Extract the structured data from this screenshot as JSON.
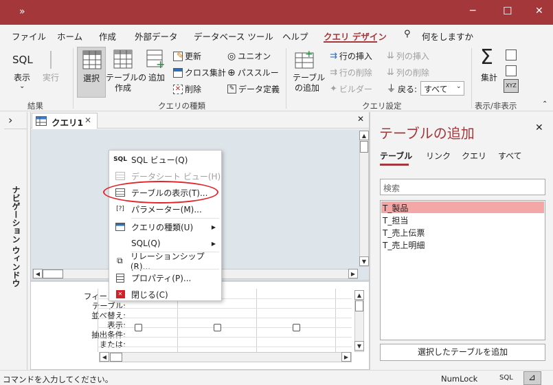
{
  "titlebar": {
    "qat_label": "»",
    "minimize": "─",
    "maximize": "☐",
    "close": "✕"
  },
  "tabs": [
    "ファイル",
    "ホーム",
    "作成",
    "外部データ",
    "データベース ツール",
    "ヘルプ",
    "クエリ デザイン"
  ],
  "tell_me": "何をしますか",
  "ribbon": {
    "results": {
      "sql_icon": "SQL",
      "view": "表示",
      "view_arrow": "⌄",
      "run": "実行",
      "group": "結果"
    },
    "query_type": {
      "select": "選択",
      "make_table_line1": "テーブルの",
      "make_table_line2": "作成",
      "append": "追加",
      "update": "更新",
      "crosstab": "クロス集計",
      "delete": "削除",
      "union": "ユニオン",
      "passthrough": "パススルー",
      "data_def": "データ定義",
      "group": "クエリの種類"
    },
    "setup": {
      "add_tables_line1": "テーブル",
      "add_tables_line2": "の追加",
      "insert_rows": "行の挿入",
      "delete_rows": "行の削除",
      "builder": "ビルダー",
      "insert_cols": "列の挿入",
      "delete_cols": "列の削除",
      "return_label": "戻る:",
      "return_value": "すべて",
      "group": "クエリ設定"
    },
    "showhide": {
      "totals": "集計",
      "xyz": "XYZ",
      "group": "表示/非表示"
    }
  },
  "nav_pane": {
    "expand": "›",
    "label": "ナビゲーション ウィンドウ"
  },
  "document": {
    "tab_title": "クエリ1",
    "tab_close": "✕",
    "doc_close": "✕"
  },
  "grid": {
    "rows": [
      "フィールド:",
      "テーブル:",
      "並べ替え:",
      "表示:",
      "抽出条件:",
      "または:"
    ]
  },
  "context_menu": [
    {
      "icon": "SQL",
      "label": "SQL ビュー(Q)",
      "enabled": true,
      "submenu": false
    },
    {
      "icon": "datasheet",
      "label": "データシート ビュー(H)",
      "enabled": false,
      "submenu": false
    },
    {
      "icon": "table",
      "label": "テーブルの表示(T)...",
      "enabled": true,
      "submenu": false,
      "highlighted": true
    },
    {
      "icon": "params",
      "label": "パラメーター(M)...",
      "enabled": true,
      "submenu": false
    },
    {
      "icon": "querytype",
      "label": "クエリの種類(U)",
      "enabled": true,
      "submenu": true
    },
    {
      "icon": "",
      "label": "SQL(Q)",
      "enabled": true,
      "submenu": true
    },
    {
      "icon": "relations",
      "label": "リレーションシップ(R)...",
      "enabled": true,
      "submenu": false
    },
    {
      "icon": "props",
      "label": "プロパティ(P)...",
      "enabled": true,
      "submenu": false
    },
    {
      "icon": "closeq",
      "label": "閉じる(C)",
      "enabled": true,
      "submenu": false
    }
  ],
  "add_tables_pane": {
    "title": "テーブルの追加",
    "close": "✕",
    "tabs": [
      "テーブル",
      "リンク",
      "クエリ",
      "すべて"
    ],
    "search_placeholder": "検索",
    "items": [
      "T_製品",
      "T_担当",
      "T_売上伝票",
      "T_売上明細"
    ],
    "selected_index": 0,
    "add_button": "選択したテーブルを追加"
  },
  "statusbar": {
    "left": "コマンドを入力してください。",
    "numlock": "NumLock",
    "sql": "SQL"
  },
  "colors": {
    "accent": "#a4373a",
    "selection": "#f4a7a7",
    "highlight_oval": "#e0242a"
  }
}
